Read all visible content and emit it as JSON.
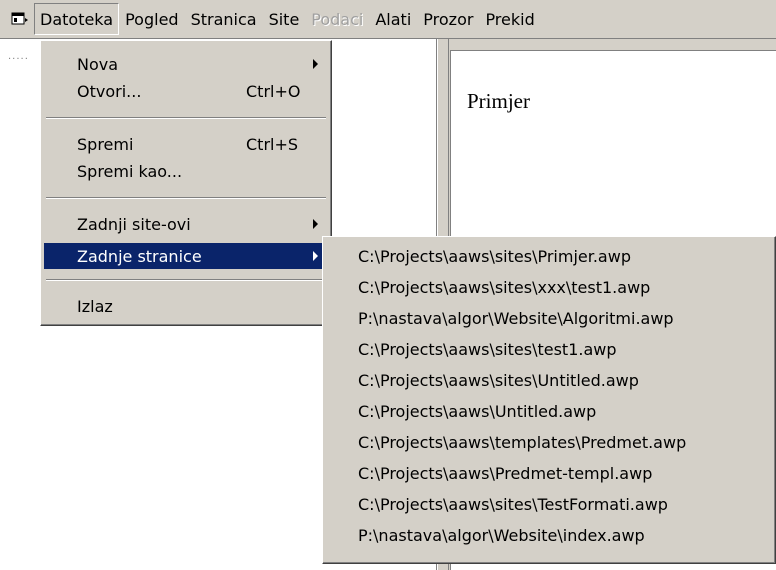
{
  "menubar": {
    "items": [
      {
        "label": "Datoteka"
      },
      {
        "label": "Pogled"
      },
      {
        "label": "Stranica"
      },
      {
        "label": "Site"
      },
      {
        "label": "Podaci"
      },
      {
        "label": "Alati"
      },
      {
        "label": "Prozor"
      },
      {
        "label": "Prekid"
      }
    ]
  },
  "document": {
    "text": "Primjer"
  },
  "file_menu": {
    "items": [
      {
        "label": "Nova",
        "shortcut": ""
      },
      {
        "label": "Otvori...",
        "shortcut": "Ctrl+O"
      },
      {
        "label": "Spremi",
        "shortcut": "Ctrl+S"
      },
      {
        "label": "Spremi kao...",
        "shortcut": ""
      },
      {
        "label": "Zadnji site-ovi",
        "shortcut": ""
      },
      {
        "label": "Zadnje stranice",
        "shortcut": ""
      },
      {
        "label": "Izlaz",
        "shortcut": ""
      }
    ]
  },
  "recent_pages": {
    "items": [
      "C:\\Projects\\aaws\\sites\\Primjer.awp",
      "C:\\Projects\\aaws\\sites\\xxx\\test1.awp",
      "P:\\nastava\\algor\\Website\\Algoritmi.awp",
      "C:\\Projects\\aaws\\sites\\test1.awp",
      "C:\\Projects\\aaws\\sites\\Untitled.awp",
      "C:\\Projects\\aaws\\Untitled.awp",
      "C:\\Projects\\aaws\\templates\\Predmet.awp",
      "C:\\Projects\\aaws\\Predmet-templ.awp",
      "C:\\Projects\\aaws\\sites\\TestFormati.awp",
      "P:\\nastava\\algor\\Website\\index.awp"
    ]
  },
  "colors": {
    "menu_bg": "#d4d0c8",
    "selection": "#0a246a",
    "disabled": "#a0a0a0"
  }
}
